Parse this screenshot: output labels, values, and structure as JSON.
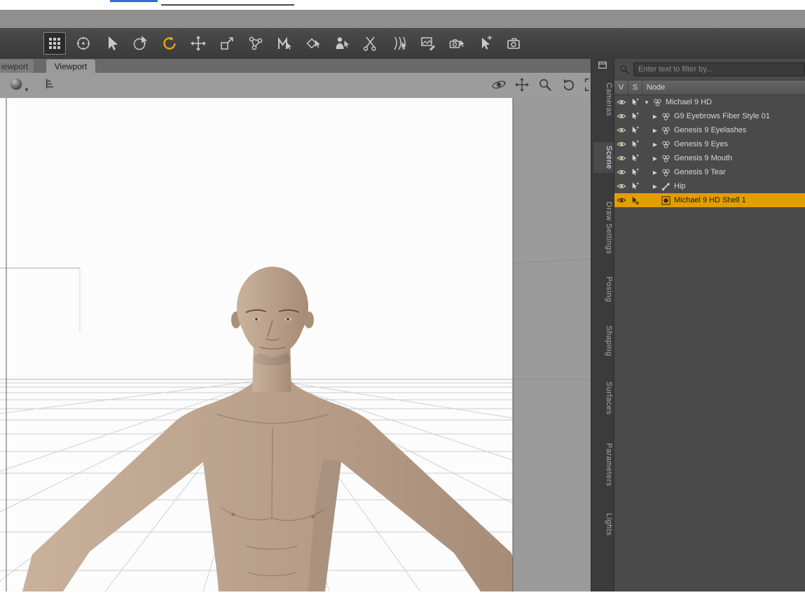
{
  "menu_strip": {
    "accent_color": "#2e6fd6"
  },
  "toolbar": {
    "tools": [
      {
        "name": "grid-snap-tool",
        "symbol": "grid",
        "pressed": true
      },
      {
        "name": "universal-manipulator-tool",
        "symbol": "sphere"
      },
      {
        "name": "node-selection-tool",
        "symbol": "cursor"
      },
      {
        "name": "region-select-tool",
        "symbol": "cursor-circle"
      },
      {
        "name": "rotate-tool",
        "symbol": "rotate",
        "active": true
      },
      {
        "name": "translate-tool",
        "symbol": "move"
      },
      {
        "name": "scale-tool",
        "symbol": "scale"
      },
      {
        "name": "joint-editor-tool",
        "symbol": "nodes"
      },
      {
        "name": "measure-tool",
        "symbol": "measure"
      },
      {
        "name": "geometry-editor-tool",
        "symbol": "diamond"
      },
      {
        "name": "figure-setup-tool",
        "symbol": "person"
      },
      {
        "name": "cut-tool",
        "symbol": "cut"
      },
      {
        "name": "hair-strand-tool",
        "symbol": "strands"
      },
      {
        "name": "image-editor-tool",
        "symbol": "image"
      },
      {
        "name": "camera-cursor-tool",
        "symbol": "camera-cursor"
      },
      {
        "name": "pointer-nav-tool",
        "symbol": "cursor-arrows"
      },
      {
        "name": "camera-tool",
        "symbol": "camera"
      }
    ]
  },
  "tabs": {
    "items": [
      {
        "label": "iewport",
        "active": false
      },
      {
        "label": "Viewport",
        "active": true
      }
    ]
  },
  "viewport": {
    "left_controls": [
      {
        "name": "drawstyle-sphere-dropdown",
        "symbol": "sphere-solid"
      },
      {
        "name": "outline-list-icon",
        "symbol": "list"
      }
    ],
    "right_controls": [
      {
        "name": "orbit-view-icon",
        "symbol": "orbit"
      },
      {
        "name": "pan-view-icon",
        "symbol": "move"
      },
      {
        "name": "zoom-view-icon",
        "symbol": "magnify"
      },
      {
        "name": "rotate-view-icon",
        "symbol": "undo"
      },
      {
        "name": "frame-view-icon",
        "symbol": "frame"
      }
    ]
  },
  "side_tabs": {
    "items": [
      "Cameras",
      "Scene",
      "Draw Settings",
      "Posing",
      "Shaping",
      "Surfaces",
      "Parameters",
      "Lights"
    ],
    "active": "Scene"
  },
  "scene_panel": {
    "filter_placeholder": "Enter text to filter by...",
    "columns": [
      "V",
      "S",
      "Node"
    ],
    "selected_color": "#e29e04",
    "rows": [
      {
        "label": "Michael 9 HD",
        "depth": 0,
        "expander": "expanded",
        "icon": "group",
        "pointer": "default"
      },
      {
        "label": "G9 Eyebrows Fiber Style 01",
        "depth": 1,
        "expander": "collapsed",
        "icon": "group",
        "pointer": "default"
      },
      {
        "label": "Genesis 9 Eyelashes",
        "depth": 1,
        "expander": "collapsed",
        "icon": "group",
        "pointer": "default"
      },
      {
        "label": "Genesis 9 Eyes",
        "depth": 1,
        "expander": "collapsed",
        "icon": "group",
        "pointer": "default"
      },
      {
        "label": "Genesis 9 Mouth",
        "depth": 1,
        "expander": "collapsed",
        "icon": "group",
        "pointer": "default"
      },
      {
        "label": "Genesis 9 Tear",
        "depth": 1,
        "expander": "collapsed",
        "icon": "group",
        "pointer": "default"
      },
      {
        "label": "Hip",
        "depth": 1,
        "expander": "collapsed",
        "icon": "bone",
        "pointer": "default"
      },
      {
        "label": "Michael 9 HD Shell 1",
        "depth": 1,
        "expander": "none",
        "icon": "shell",
        "pointer": "x",
        "selected": true
      }
    ]
  }
}
